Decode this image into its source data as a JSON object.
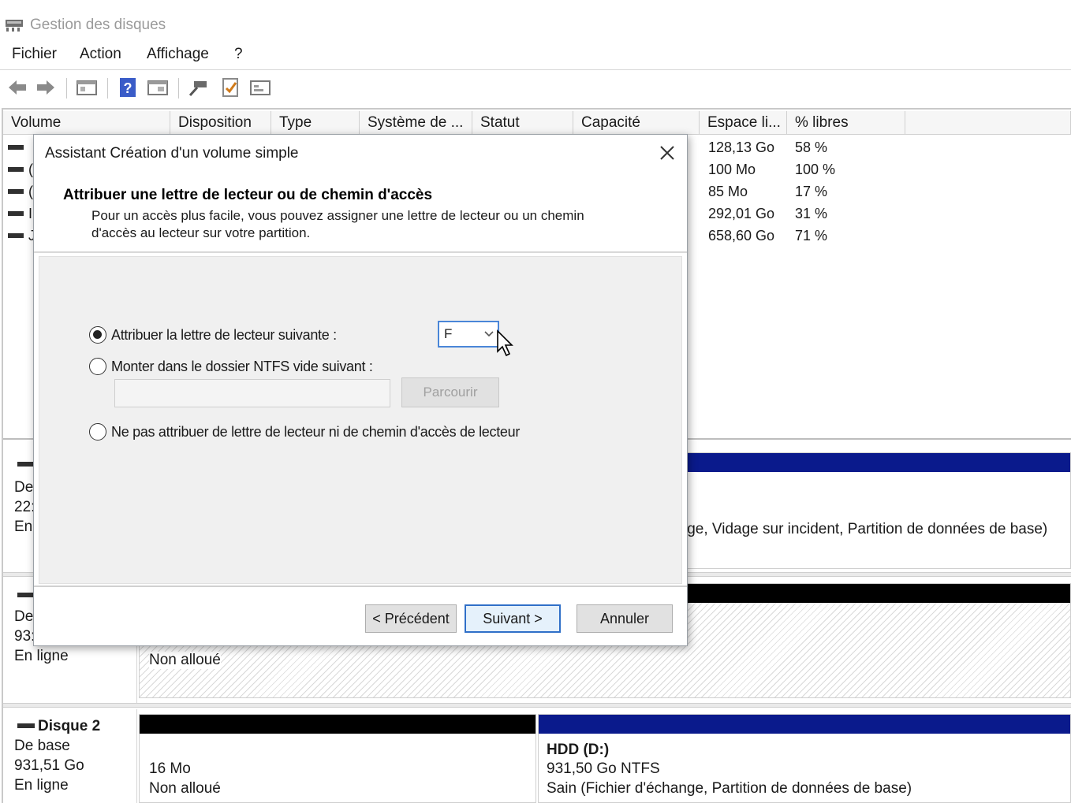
{
  "window": {
    "title": "Gestion des disques"
  },
  "menu": [
    "Fichier",
    "Action",
    "Affichage",
    "?"
  ],
  "columns": [
    "Volume",
    "Disposition",
    "Type",
    "Système de ...",
    "Statut",
    "Capacité",
    "Espace li...",
    "% libres"
  ],
  "volumes": [
    {
      "free": "128,13 Go",
      "pct": "58 %"
    },
    {
      "free": "100 Mo",
      "pct": "100 %"
    },
    {
      "free": "85 Mo",
      "pct": "17 %"
    },
    {
      "free": "292,01 Go",
      "pct": "31 %"
    },
    {
      "free": "658,60 Go",
      "pct": "71 %"
    }
  ],
  "volume_name_fragments": [
    "",
    "(",
    "(",
    "I",
    "J"
  ],
  "disk0": {
    "lines": [
      "De",
      "22:",
      "En"
    ],
    "partition_text": "ige, Vidage sur incident, Partition de données de base)"
  },
  "disk1": {
    "lines": [
      "De",
      "93:",
      "En ligne"
    ],
    "unallocated": "Non alloué"
  },
  "disk2": {
    "name": "Disque 2",
    "lines": [
      "De base",
      "931,51 Go",
      "En ligne"
    ],
    "part1": {
      "size": "16 Mo",
      "status": "Non alloué"
    },
    "part2": {
      "name": "HDD  (D:)",
      "size": "931,50 Go NTFS",
      "status": "Sain (Fichier d'échange, Partition de données de base)"
    }
  },
  "dialog": {
    "title": "Assistant Création d'un volume simple",
    "heading": "Attribuer une lettre de lecteur ou de chemin d'accès",
    "description": "Pour un accès plus facile, vous pouvez assigner une lettre de lecteur ou un chemin d'accès au lecteur sur votre partition.",
    "option_letter": "Attribuer la lettre de lecteur suivante :",
    "option_folder": "Monter dans le dossier NTFS vide suivant :",
    "option_none": "Ne pas attribuer de lettre de lecteur ni de chemin d'accès de lecteur",
    "selected_letter": "F",
    "browse": "Parcourir",
    "back": "< Précédent",
    "next": "Suivant >",
    "cancel": "Annuler"
  },
  "colors": {
    "primary_partition_bar": "#0a1a8c",
    "unallocated_bar": "#000000",
    "focus_border": "#2f6fc8"
  }
}
